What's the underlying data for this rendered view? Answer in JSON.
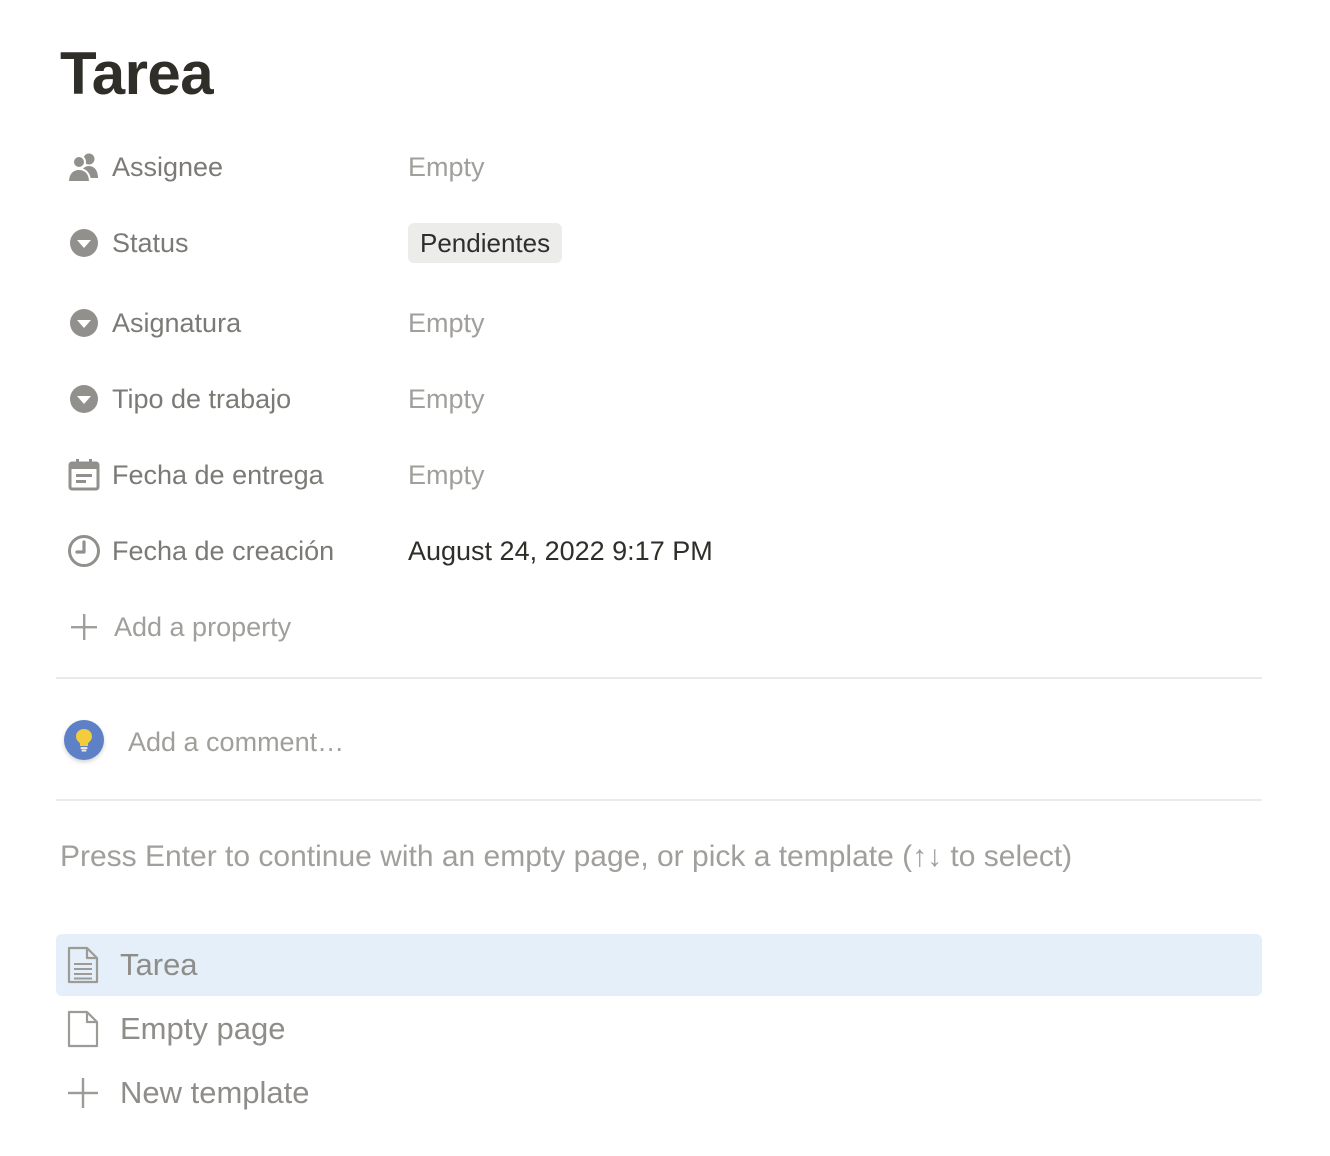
{
  "page": {
    "title": "Tarea"
  },
  "properties": [
    {
      "name": "Assignee",
      "icon": "people-icon",
      "value": "Empty"
    },
    {
      "name": "Status",
      "icon": "select-icon",
      "value": "Pendientes"
    },
    {
      "name": "Asignatura",
      "icon": "select-icon",
      "value": "Empty"
    },
    {
      "name": "Tipo de trabajo",
      "icon": "select-icon",
      "value": "Empty"
    },
    {
      "name": "Fecha de entrega",
      "icon": "calendar-icon",
      "value": "Empty"
    },
    {
      "name": "Fecha de creación",
      "icon": "clock-icon",
      "value": "August 24, 2022 9:17 PM"
    }
  ],
  "add_property": {
    "label": "Add a property",
    "icon": "plus-icon"
  },
  "comment": {
    "placeholder": "Add a comment…",
    "avatar_icon": "lightbulb-icon"
  },
  "templates": {
    "hint": "Press Enter to continue with an empty page, or pick a template (↑↓ to select)",
    "items": [
      {
        "label": "Tarea",
        "icon": "document-icon",
        "selected": true
      },
      {
        "label": "Empty page",
        "icon": "blank-page-icon",
        "selected": false
      },
      {
        "label": "New template",
        "icon": "plus-icon",
        "selected": false
      }
    ]
  },
  "colors": {
    "selected_background": "#e4eff9",
    "status_pill_background": "#ececea",
    "avatar_background": "#5d80c6"
  }
}
